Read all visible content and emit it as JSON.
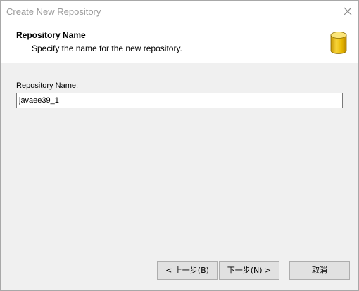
{
  "window": {
    "title": "Create New Repository",
    "close_icon": "close-icon"
  },
  "header": {
    "title": "Repository Name",
    "subtitle": "Specify the name for the new repository.",
    "icon": "database-icon",
    "icon_color": "#e8b800"
  },
  "form": {
    "label_mnemonic": "R",
    "label_rest": "epository Name:",
    "value": "javaee39_1"
  },
  "footer": {
    "back_label": "< 上一步(B)",
    "next_label": "下一步(N) >",
    "cancel_label": "取消"
  }
}
